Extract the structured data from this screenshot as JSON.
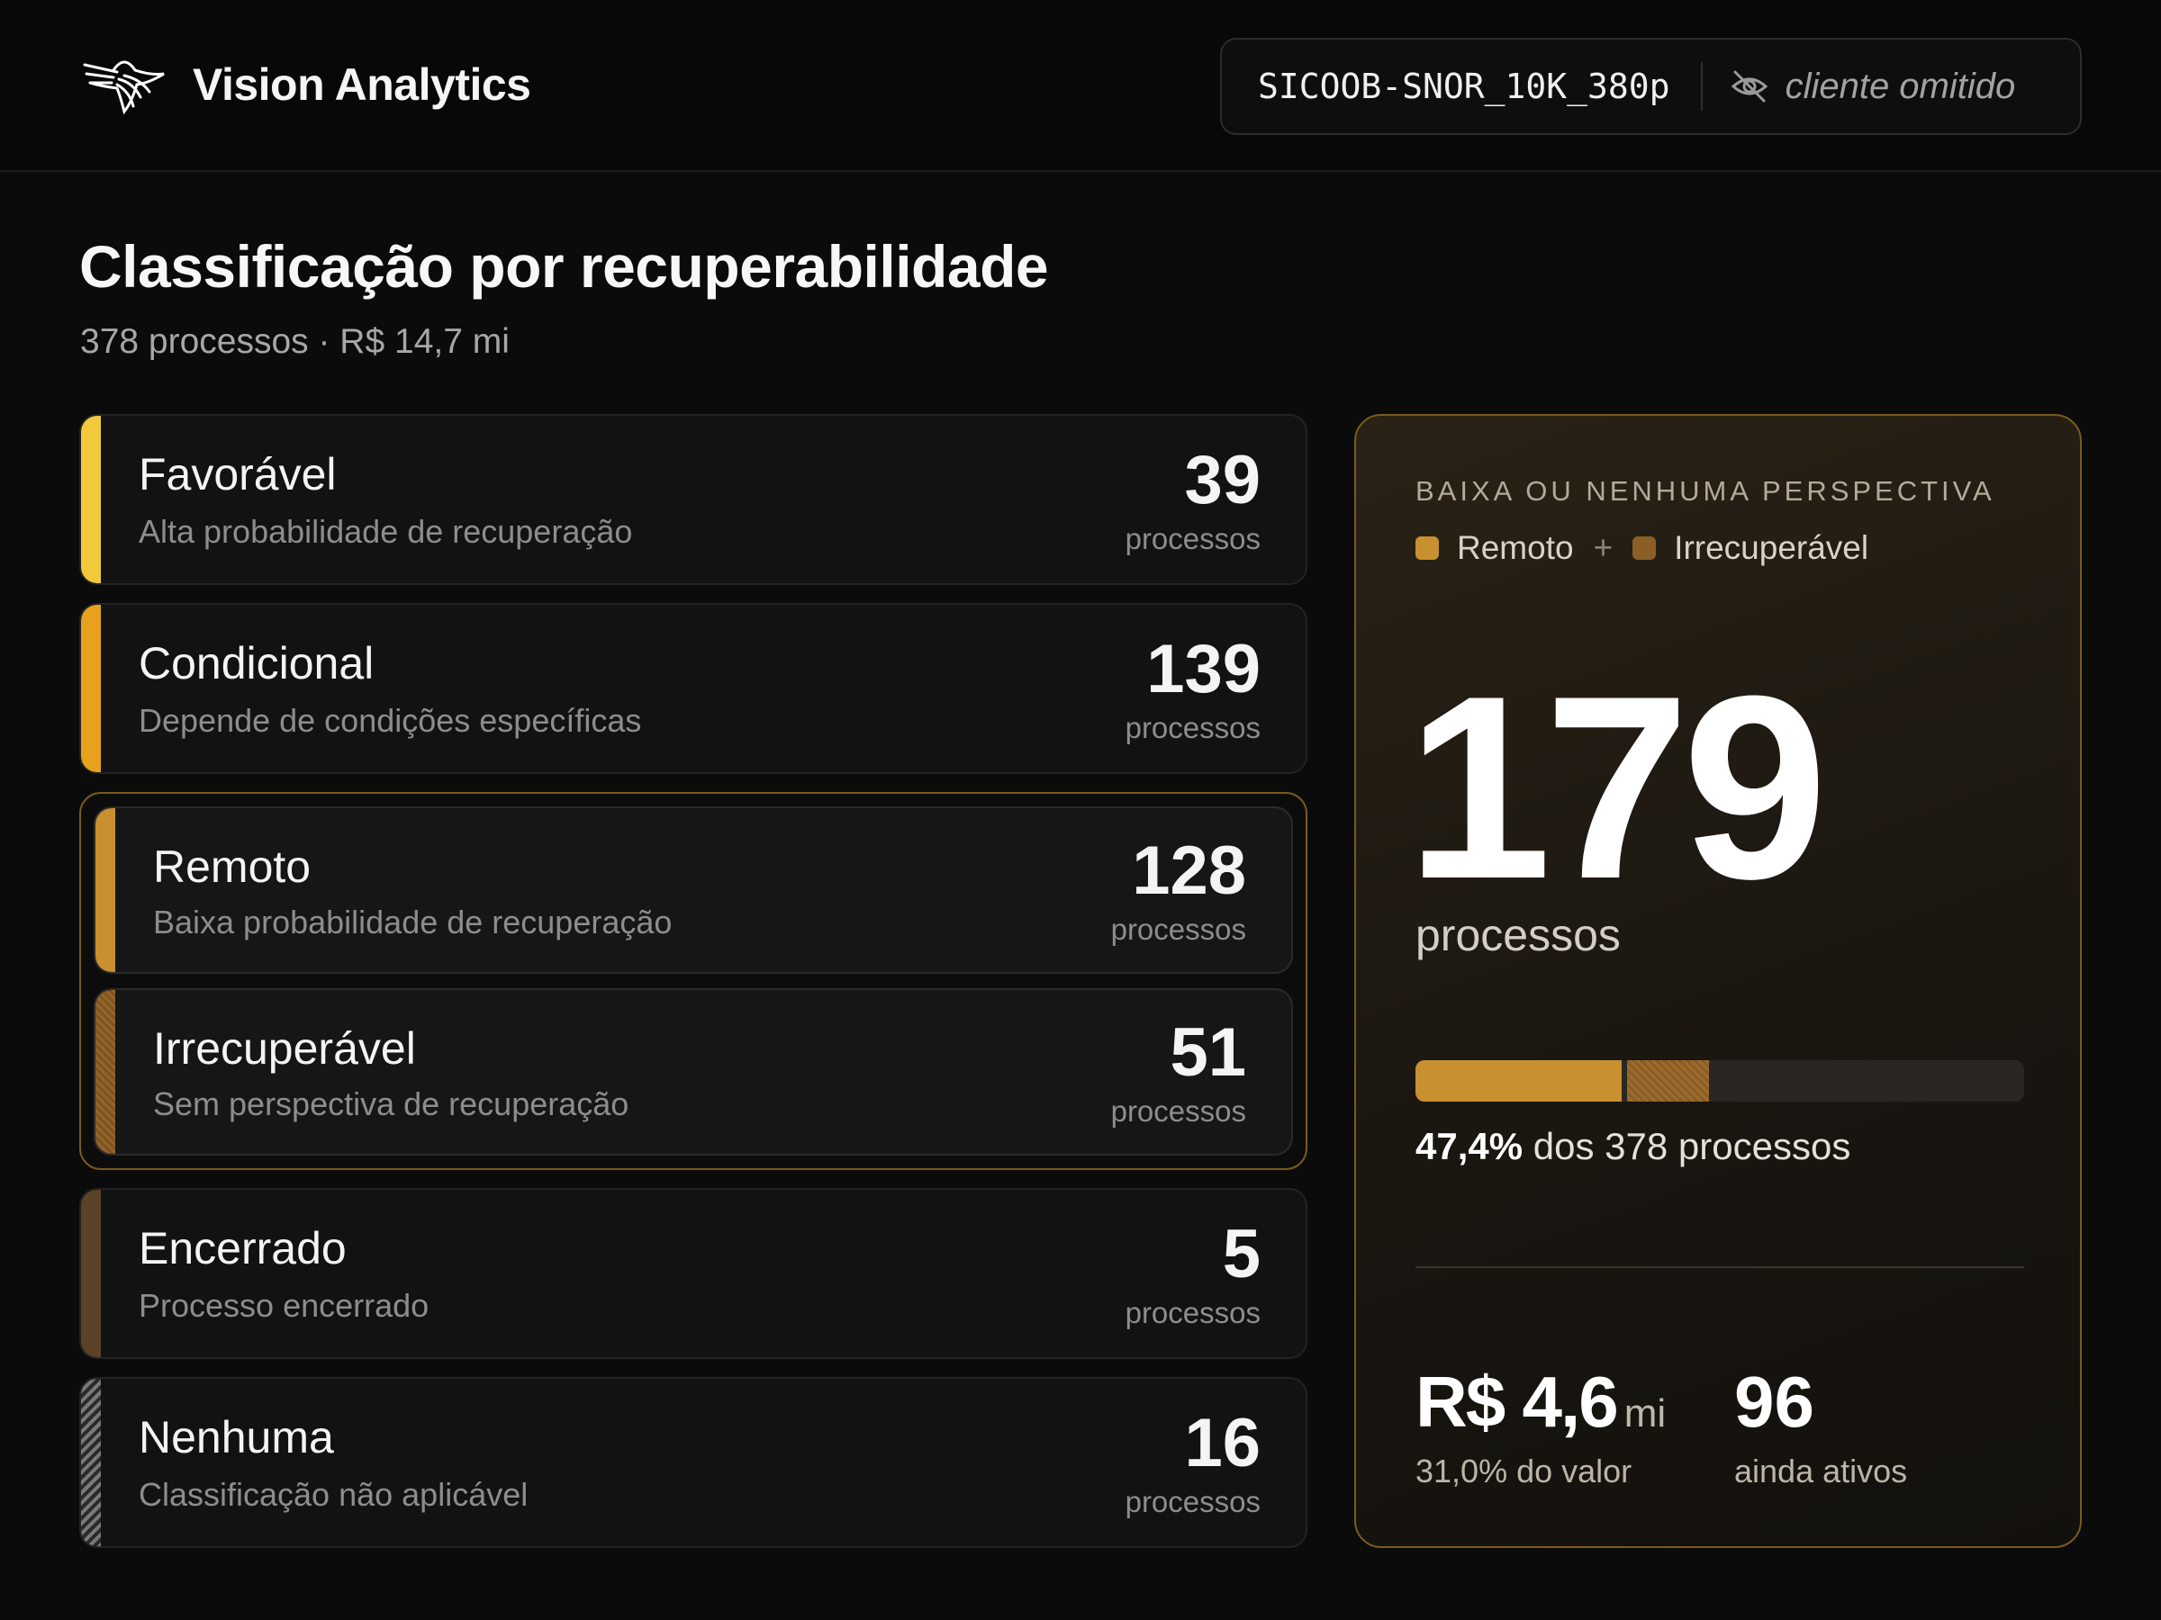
{
  "header": {
    "brand_name": "Vision Analytics",
    "context_code": "SICOOB-SNOR_10K_380p",
    "client_label": "cliente omitido"
  },
  "page": {
    "title": "Classificação por recuperabilidade",
    "subtitle": "378 processos · R$ 14,7 mi"
  },
  "categories": [
    {
      "name": "Favorável",
      "description": "Alta probabilidade de recuperação",
      "count": "39",
      "unit": "processos",
      "color": "#f2c93a"
    },
    {
      "name": "Condicional",
      "description": "Depende de condições específicas",
      "count": "139",
      "unit": "processos",
      "color": "#e6a21f"
    },
    {
      "name": "Remoto",
      "description": "Baixa probabilidade de recuperação",
      "count": "128",
      "unit": "processos",
      "color": "#c8902e"
    },
    {
      "name": "Irrecuperável",
      "description": "Sem perspectiva de recuperação",
      "count": "51",
      "unit": "processos",
      "color": "#8a5e26"
    },
    {
      "name": "Encerrado",
      "description": "Processo encerrado",
      "count": "5",
      "unit": "processos",
      "color": "#5a4327"
    },
    {
      "name": "Nenhuma",
      "description": "Classificação não aplicável",
      "count": "16",
      "unit": "processos",
      "color": "#6b6b6b"
    }
  ],
  "summary": {
    "label": "BAIXA OU NENHUMA PERSPECTIVA",
    "legend": [
      {
        "name": "Remoto",
        "color": "#c8902e"
      },
      {
        "name": "Irrecuperável",
        "color": "#8a5e26"
      }
    ],
    "legend_join": "+",
    "total": "179",
    "total_unit": "processos",
    "share": {
      "remoto_fraction": 0.3386,
      "irrecuperavel_fraction": 0.1349
    },
    "percent_value": "47,4%",
    "percent_text": "dos 378 processos",
    "value_amount": "R$ 4,6",
    "value_unit": "mi",
    "value_sub": "31,0% do valor",
    "active_count": "96",
    "active_sub": "ainda ativos"
  }
}
